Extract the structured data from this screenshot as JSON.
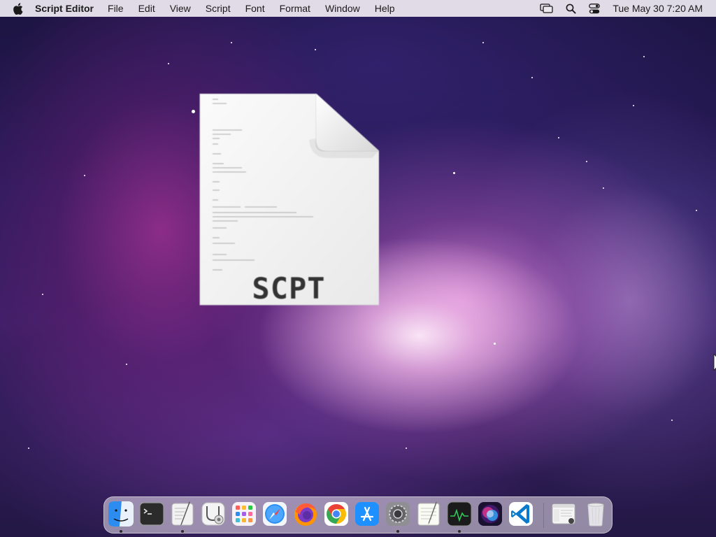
{
  "menubar": {
    "app_name": "Script Editor",
    "menus": [
      "File",
      "Edit",
      "View",
      "Script",
      "Font",
      "Format",
      "Window",
      "Help"
    ],
    "clock": "Tue May 30  7:20 AM",
    "status_icons": [
      "screen-mirroring-icon",
      "spotlight-search-icon",
      "control-center-icon"
    ]
  },
  "desktop": {
    "file_icon": {
      "label": "SCPT",
      "icon": "applescript-document-icon"
    }
  },
  "dock": {
    "apps": [
      {
        "name": "Finder",
        "icon": "finder-icon",
        "running": true
      },
      {
        "name": "Terminal",
        "icon": "terminal-icon",
        "running": false
      },
      {
        "name": "Script Editor",
        "icon": "script-editor-icon",
        "running": true
      },
      {
        "name": "System Information",
        "icon": "system-information-icon",
        "running": false
      },
      {
        "name": "Launchpad",
        "icon": "launchpad-icon",
        "running": false
      },
      {
        "name": "Safari",
        "icon": "safari-icon",
        "running": false
      },
      {
        "name": "Firefox",
        "icon": "firefox-icon",
        "running": false
      },
      {
        "name": "Chrome",
        "icon": "chrome-icon",
        "running": false
      },
      {
        "name": "App Store",
        "icon": "app-store-icon",
        "running": false
      },
      {
        "name": "System Preferences",
        "icon": "system-preferences-icon",
        "running": true
      },
      {
        "name": "TextEdit",
        "icon": "textedit-icon",
        "running": false
      },
      {
        "name": "Activity Monitor",
        "icon": "activity-monitor-icon",
        "running": true
      },
      {
        "name": "Siri",
        "icon": "siri-icon",
        "running": false
      },
      {
        "name": "Visual Studio Code",
        "icon": "vscode-icon",
        "running": false
      }
    ],
    "stack": {
      "name": "Downloads",
      "icon": "downloads-stack-icon"
    },
    "trash": {
      "name": "Trash",
      "icon": "trash-icon"
    }
  }
}
